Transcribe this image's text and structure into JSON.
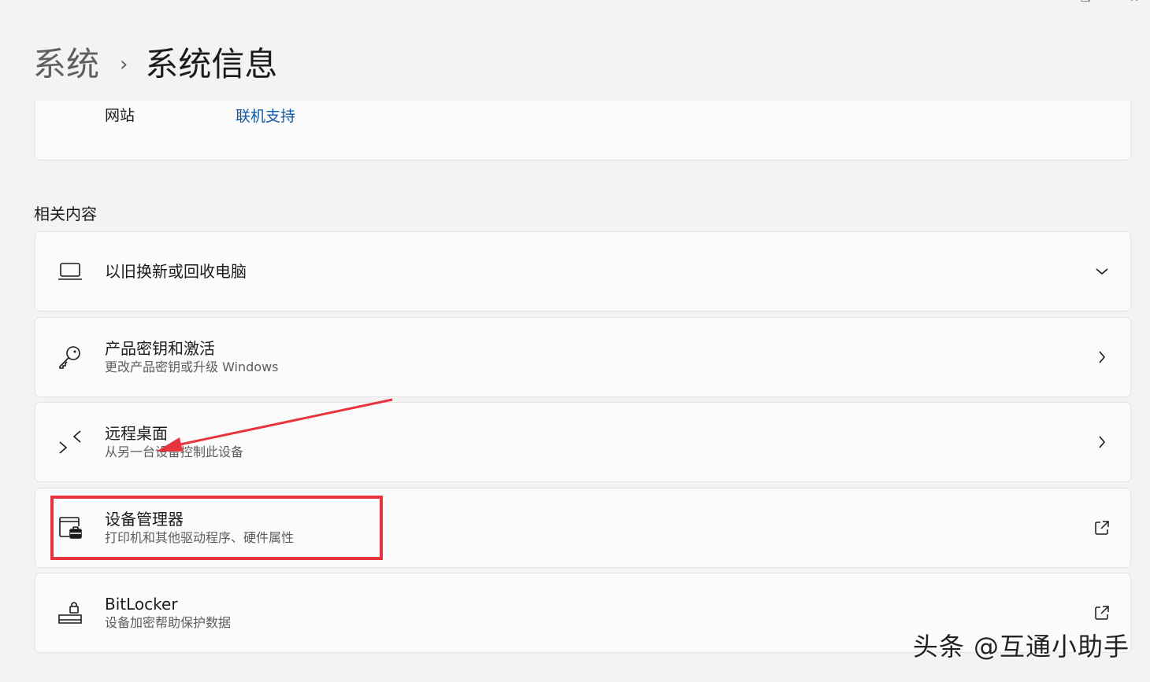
{
  "breadcrumb": {
    "parent": "系统",
    "separator": "›",
    "current": "系统信息"
  },
  "support": {
    "label": "网站",
    "link": "联机支持"
  },
  "related": {
    "title": "相关内容",
    "items": [
      {
        "icon": "laptop-icon",
        "title": "以旧换新或回收电脑",
        "subtitle": "",
        "trail": "chevron-down-icon"
      },
      {
        "icon": "key-icon",
        "title": "产品密钥和激活",
        "subtitle": "更改产品密钥或升级 Windows",
        "trail": "chevron-right-icon"
      },
      {
        "icon": "remote-desktop-icon",
        "title": "远程桌面",
        "subtitle": "从另一台设备控制此设备",
        "trail": "chevron-right-icon"
      },
      {
        "icon": "device-manager-icon",
        "title": "设备管理器",
        "subtitle": "打印机和其他驱动程序、硬件属性",
        "trail": "external-link-icon"
      },
      {
        "icon": "bitlocker-icon",
        "title": "BitLocker",
        "subtitle": "设备加密帮助保护数据",
        "trail": "external-link-icon"
      }
    ]
  },
  "colors": {
    "accent_link": "#0d5aa7",
    "annotation_red": "#e8353d"
  },
  "watermark": "头条 @互通小助手"
}
